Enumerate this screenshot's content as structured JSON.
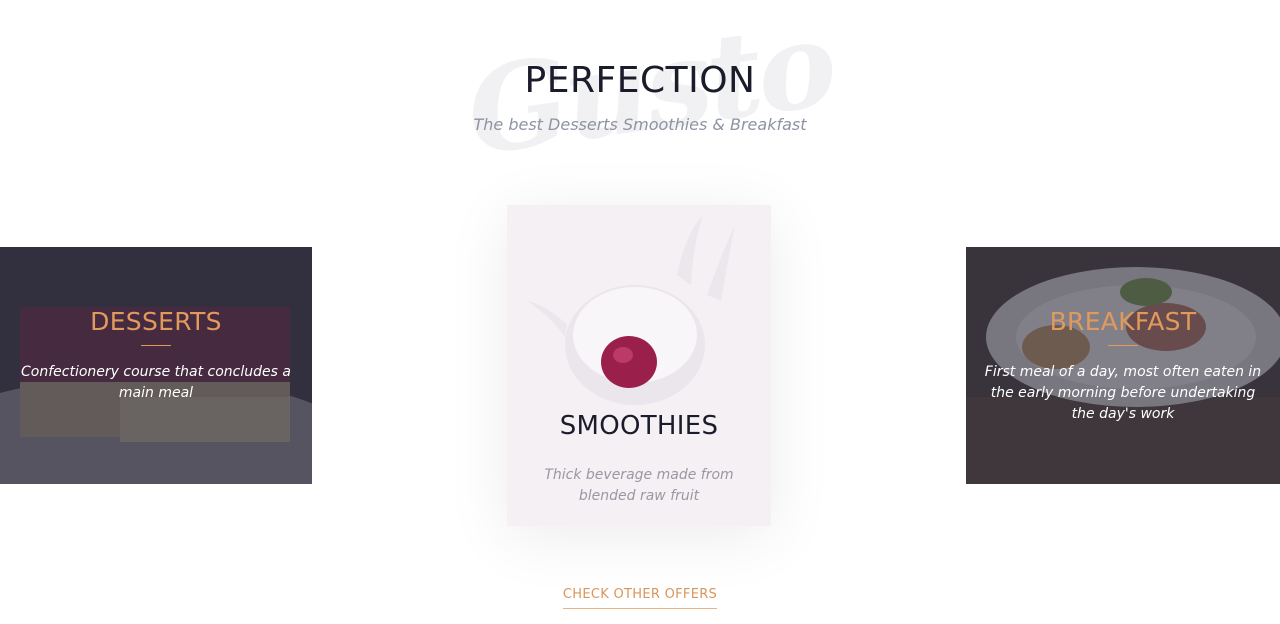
{
  "header": {
    "watermark": "Gusto",
    "title": "PERFECTION",
    "subtitle": "The best Desserts Smoothies & Breakfast"
  },
  "cards": [
    {
      "title": "DESSERTS",
      "description": "Confectionery course that concludes a main meal"
    },
    {
      "title": "SMOOTHIES",
      "description": "Thick beverage made from blended raw fruit"
    },
    {
      "title": "BREAKFAST",
      "description": "First meal of a day, most often eaten in the early morning before undertaking the day's work"
    }
  ],
  "cta": {
    "label": "CHECK OTHER OFFERS"
  },
  "colors": {
    "accent": "#e19a5c",
    "heading": "#1b1c2b",
    "muted": "#8e93a3"
  }
}
